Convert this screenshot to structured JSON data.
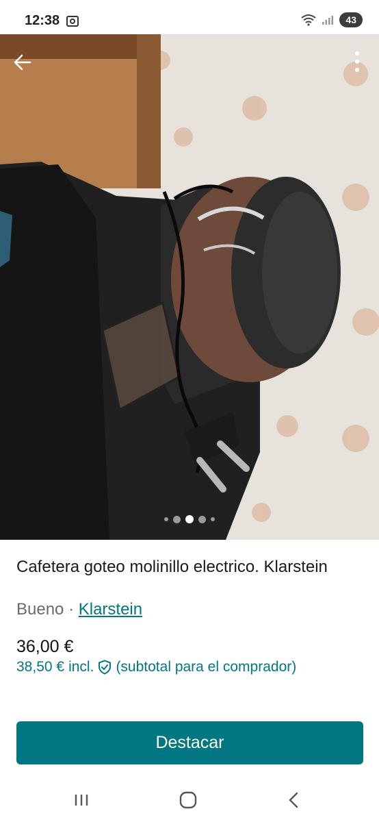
{
  "status_bar": {
    "time": "12:38",
    "battery": "43"
  },
  "listing": {
    "title": "Cafetera goteo molinillo electrico. Klarstein",
    "condition": "Bueno",
    "separator": " · ",
    "brand": "Klarstein",
    "price": "36,00 €",
    "buyer_price": "38,50 €",
    "buyer_incl": "incl.",
    "buyer_note": "(subtotal para el comprador)"
  },
  "gallery": {
    "photo_count": 5,
    "active_index": 2
  },
  "actions": {
    "promote_label": "Destacar"
  },
  "colors": {
    "accent": "#007782"
  }
}
